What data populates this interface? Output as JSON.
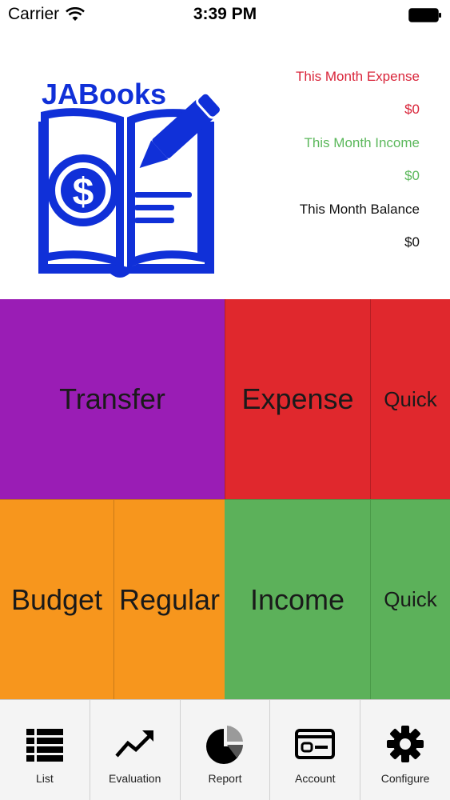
{
  "status_bar": {
    "carrier": "Carrier",
    "time": "3:39 PM"
  },
  "logo": {
    "text": "JABooks",
    "icon": "book-pencil-dollar-logo",
    "color": "#1030d8"
  },
  "summary": {
    "expense_label": "This Month Expense",
    "expense_value": "$0",
    "income_label": "This Month Income",
    "income_value": "$0",
    "balance_label": "This Month Balance",
    "balance_value": "$0",
    "expense_color": "#d9253a",
    "income_color": "#5cb85c",
    "balance_color": "#111111"
  },
  "tiles": {
    "transfer": "Transfer",
    "expense": "Expense",
    "quick_expense": "Quick",
    "budget": "Budget",
    "regular": "Regular",
    "income": "Income",
    "quick_income": "Quick",
    "colors": {
      "transfer": "#9a1db5",
      "expense": "#e0282d",
      "budget": "#f7961d",
      "income": "#5cb15a"
    }
  },
  "tab_bar": {
    "items": [
      {
        "label": "List",
        "icon": "list-icon"
      },
      {
        "label": "Evaluation",
        "icon": "trend-up-icon"
      },
      {
        "label": "Report",
        "icon": "pie-chart-icon"
      },
      {
        "label": "Account",
        "icon": "card-icon"
      },
      {
        "label": "Configure",
        "icon": "gear-icon"
      }
    ]
  }
}
